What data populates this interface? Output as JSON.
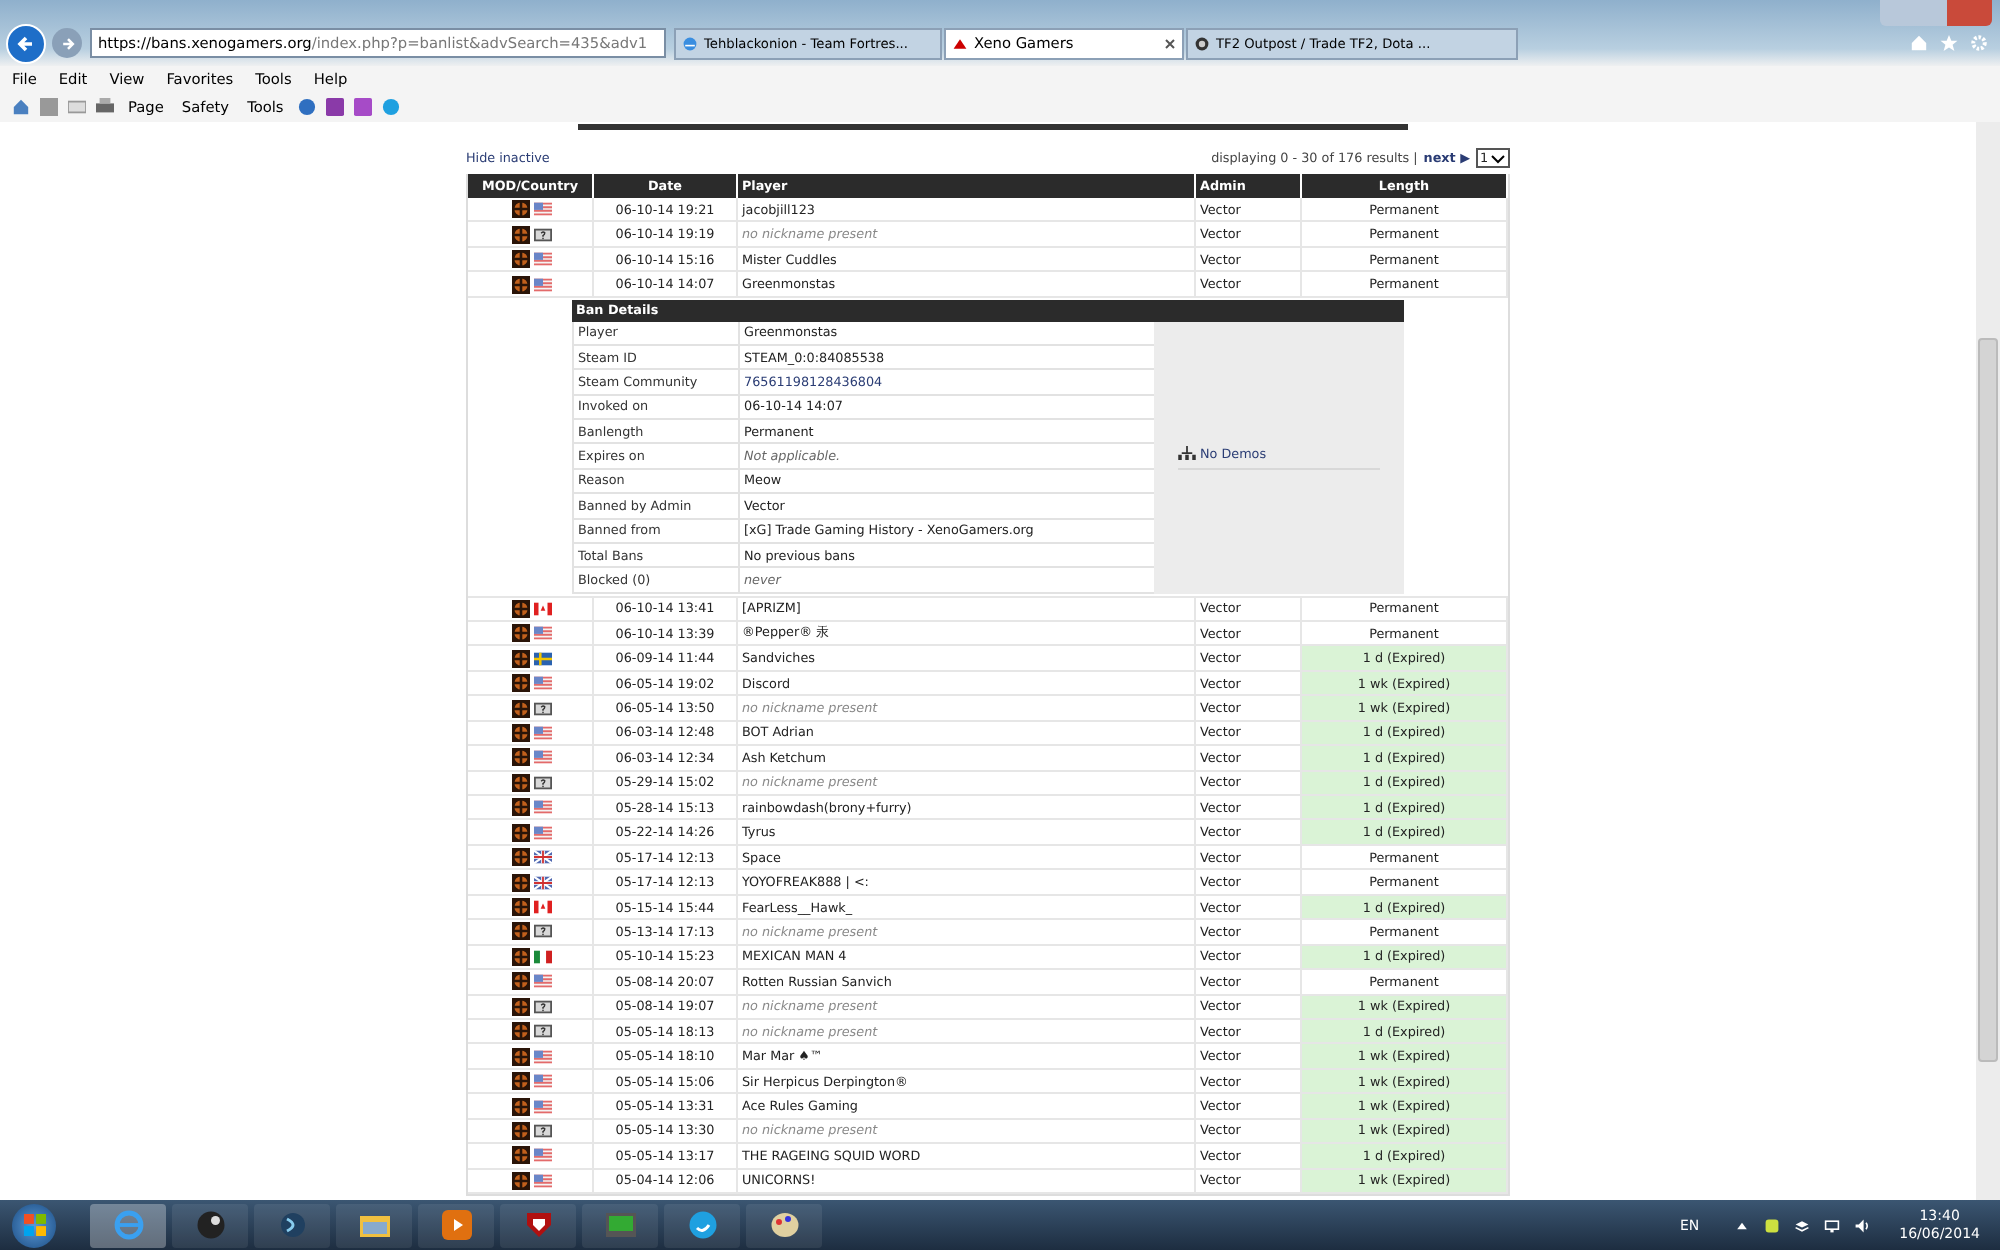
{
  "browser": {
    "address": {
      "host": "https://bans.xenogamers.org",
      "path": "/index.php?p=banlist&advSearch=435&adv1"
    },
    "tabs": [
      {
        "title": "Tehblackonion - Team Fortres...",
        "selected": false
      },
      {
        "title": "Xeno Gamers",
        "selected": true
      },
      {
        "title": "TF2 Outpost / Trade TF2, Dota ...",
        "selected": false
      }
    ],
    "menu": [
      "File",
      "Edit",
      "View",
      "Favorites",
      "Tools",
      "Help"
    ],
    "commands": [
      "Page",
      "Safety",
      "Tools"
    ]
  },
  "page": {
    "hide_inactive": "Hide inactive",
    "pagination": {
      "summary": "displaying 0 - 30 of 176 results |",
      "next": "next ▶",
      "page": "1"
    },
    "columns": [
      "MOD/Country",
      "Date",
      "Player",
      "Admin",
      "Length"
    ],
    "rows_before": [
      {
        "kind": "us",
        "date": "06-10-14 19:21",
        "player": "jacobjill123",
        "no_nickname": false,
        "admin": "Vector",
        "length": "Permanent",
        "expired": false
      },
      {
        "kind": "unknown",
        "date": "06-10-14 19:19",
        "player": "no nickname present",
        "no_nickname": true,
        "admin": "Vector",
        "length": "Permanent",
        "expired": false
      },
      {
        "kind": "us",
        "date": "06-10-14 15:16",
        "player": "Mister Cuddles",
        "no_nickname": false,
        "admin": "Vector",
        "length": "Permanent",
        "expired": false
      },
      {
        "kind": "us",
        "date": "06-10-14 14:07",
        "player": "Greenmonstas",
        "no_nickname": false,
        "admin": "Vector",
        "length": "Permanent",
        "expired": false
      }
    ],
    "details": {
      "title": "Ban Details",
      "fields": [
        {
          "label": "Player",
          "value": "Greenmonstas",
          "kind": "plain"
        },
        {
          "label": "Steam ID",
          "value": "STEAM_0:0:84085538",
          "kind": "plain"
        },
        {
          "label": "Steam Community",
          "value": "76561198128436804",
          "kind": "link"
        },
        {
          "label": "Invoked on",
          "value": "06-10-14 14:07",
          "kind": "plain"
        },
        {
          "label": "Banlength",
          "value": "Permanent",
          "kind": "plain"
        },
        {
          "label": "Expires on",
          "value": "Not applicable.",
          "kind": "italic"
        },
        {
          "label": "Reason",
          "value": "Meow",
          "kind": "plain"
        },
        {
          "label": "Banned by Admin",
          "value": "Vector",
          "kind": "plain"
        },
        {
          "label": "Banned from",
          "value": "[xG] Trade Gaming History - XenoGamers.org",
          "kind": "plain"
        },
        {
          "label": "Total Bans",
          "value": "No previous bans",
          "kind": "plain"
        },
        {
          "label": "Blocked (0)",
          "value": "never",
          "kind": "italic"
        }
      ],
      "demos": "No Demos"
    },
    "rows_after": [
      {
        "kind": "ca",
        "date": "06-10-14 13:41",
        "player": "[APRIZM]",
        "no_nickname": false,
        "admin": "Vector",
        "length": "Permanent",
        "expired": false
      },
      {
        "kind": "us",
        "date": "06-10-14 13:39",
        "player": "®Pepper® 汞",
        "no_nickname": false,
        "admin": "Vector",
        "length": "Permanent",
        "expired": false
      },
      {
        "kind": "se",
        "date": "06-09-14 11:44",
        "player": "Sandviches",
        "no_nickname": false,
        "admin": "Vector",
        "length": "1 d (Expired)",
        "expired": true
      },
      {
        "kind": "us",
        "date": "06-05-14 19:02",
        "player": "Discord",
        "no_nickname": false,
        "admin": "Vector",
        "length": "1 wk (Expired)",
        "expired": true
      },
      {
        "kind": "unknown",
        "date": "06-05-14 13:50",
        "player": "no nickname present",
        "no_nickname": true,
        "admin": "Vector",
        "length": "1 wk (Expired)",
        "expired": true
      },
      {
        "kind": "us",
        "date": "06-03-14 12:48",
        "player": "BOT Adrian",
        "no_nickname": false,
        "admin": "Vector",
        "length": "1 d (Expired)",
        "expired": true
      },
      {
        "kind": "us",
        "date": "06-03-14 12:34",
        "player": "Ash Ketchum",
        "no_nickname": false,
        "admin": "Vector",
        "length": "1 d (Expired)",
        "expired": true
      },
      {
        "kind": "unknown",
        "date": "05-29-14 15:02",
        "player": "no nickname present",
        "no_nickname": true,
        "admin": "Vector",
        "length": "1 d (Expired)",
        "expired": true
      },
      {
        "kind": "us",
        "date": "05-28-14 15:13",
        "player": "rainbowdash(brony+furry)",
        "no_nickname": false,
        "admin": "Vector",
        "length": "1 d (Expired)",
        "expired": true
      },
      {
        "kind": "us",
        "date": "05-22-14 14:26",
        "player": "Tyrus",
        "no_nickname": false,
        "admin": "Vector",
        "length": "1 d (Expired)",
        "expired": true
      },
      {
        "kind": "gb",
        "date": "05-17-14 12:13",
        "player": "Space",
        "no_nickname": false,
        "admin": "Vector",
        "length": "Permanent",
        "expired": false
      },
      {
        "kind": "gb",
        "date": "05-17-14 12:13",
        "player": "YOYOFREAK888 | <:",
        "no_nickname": false,
        "admin": "Vector",
        "length": "Permanent",
        "expired": false
      },
      {
        "kind": "ca",
        "date": "05-15-14 15:44",
        "player": "FearLess__Hawk_",
        "no_nickname": false,
        "admin": "Vector",
        "length": "1 d (Expired)",
        "expired": true
      },
      {
        "kind": "unknown",
        "date": "05-13-14 17:13",
        "player": "no nickname present",
        "no_nickname": true,
        "admin": "Vector",
        "length": "Permanent",
        "expired": false
      },
      {
        "kind": "mx",
        "date": "05-10-14 15:23",
        "player": "MEXICAN MAN 4",
        "no_nickname": false,
        "admin": "Vector",
        "length": "1 d (Expired)",
        "expired": true
      },
      {
        "kind": "us",
        "date": "05-08-14 20:07",
        "player": "Rotten Russian Sanvich",
        "no_nickname": false,
        "admin": "Vector",
        "length": "Permanent",
        "expired": false
      },
      {
        "kind": "unknown",
        "date": "05-08-14 19:07",
        "player": "no nickname present",
        "no_nickname": true,
        "admin": "Vector",
        "length": "1 wk (Expired)",
        "expired": true
      },
      {
        "kind": "unknown",
        "date": "05-05-14 18:13",
        "player": "no nickname present",
        "no_nickname": true,
        "admin": "Vector",
        "length": "1 d (Expired)",
        "expired": true
      },
      {
        "kind": "us",
        "date": "05-05-14 18:10",
        "player": "Mar Mar ♠™",
        "no_nickname": false,
        "admin": "Vector",
        "length": "1 wk (Expired)",
        "expired": true
      },
      {
        "kind": "us",
        "date": "05-05-14 15:06",
        "player": "Sir Herpicus Derpington®",
        "no_nickname": false,
        "admin": "Vector",
        "length": "1 wk (Expired)",
        "expired": true
      },
      {
        "kind": "us",
        "date": "05-05-14 13:31",
        "player": "Ace Rules Gaming",
        "no_nickname": false,
        "admin": "Vector",
        "length": "1 wk (Expired)",
        "expired": true
      },
      {
        "kind": "unknown",
        "date": "05-05-14 13:30",
        "player": "no nickname present",
        "no_nickname": true,
        "admin": "Vector",
        "length": "1 wk (Expired)",
        "expired": true
      },
      {
        "kind": "us",
        "date": "05-05-14 13:17",
        "player": "THE RAGEING SQUID WORD",
        "no_nickname": false,
        "admin": "Vector",
        "length": "1 d (Expired)",
        "expired": true
      },
      {
        "kind": "us",
        "date": "05-04-14 12:06",
        "player": "UNICORNS!",
        "no_nickname": false,
        "admin": "Vector",
        "length": "1 wk (Expired)",
        "expired": true
      }
    ]
  },
  "taskbar": {
    "language": "EN",
    "time": "13:40",
    "date": "16/06/2014"
  }
}
